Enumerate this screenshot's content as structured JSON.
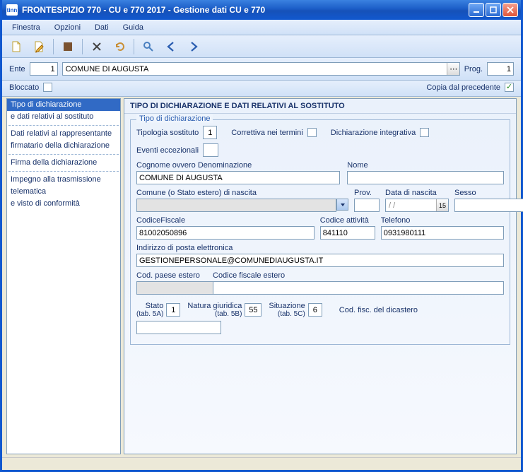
{
  "titlebar": {
    "app_prefix": "tinn",
    "title": "FRONTESPIZIO 770 - CU e 770 2017 - Gestione dati CU e 770"
  },
  "menu": {
    "finestra": "Finestra",
    "opzioni": "Opzioni",
    "dati": "Dati",
    "guida": "Guida"
  },
  "filter": {
    "ente_label": "Ente",
    "ente_value": "1",
    "ente_name": "COMUNE DI AUGUSTA",
    "prog_label": "Prog.",
    "prog_value": "1"
  },
  "lockbar": {
    "bloccato": "Bloccato",
    "bloccato_checked": false,
    "copia": "Copia dal precedente",
    "copia_checked": true
  },
  "nav": {
    "items": [
      {
        "l1": "Tipo di dichiarazione",
        "l2": "e dati relativi al sostituto",
        "selected": true
      },
      {
        "l1": "Dati relativi al rappresentante",
        "l2": "firmatario della dichiarazione"
      },
      {
        "l1": "Firma della dichiarazione",
        "l2": ""
      },
      {
        "l1": "Impegno alla trasmissione",
        "l2": "telematica",
        "l3": "e visto di conformità"
      }
    ]
  },
  "main": {
    "section_title": "TIPO DI DICHIARAZIONE E DATI RELATIVI AL SOSTITUTO",
    "fieldset_legend": "Tipo di dichiarazione",
    "labels": {
      "tipologia_sostituto": "Tipologia sostituto",
      "correttiva": "Correttiva nei termini",
      "integrativa": "Dichiarazione integrativa",
      "eventi": "Eventi eccezionali",
      "cognome_denom": "Cognome ovvero Denominazione",
      "nome": "Nome",
      "comune_nascita": "Comune (o Stato estero) di nascita",
      "prov": "Prov.",
      "data_nascita": "Data di nascita",
      "sesso": "Sesso",
      "codice_fiscale": "CodiceFiscale",
      "codice_attivita": "Codice attività",
      "telefono": "Telefono",
      "email": "Indirizzo di posta elettronica",
      "cod_paese_estero": "Cod. paese estero",
      "codice_fiscale_estero": "Codice fiscale estero",
      "stato": "Stato",
      "stato_sub": "(tab. 5A)",
      "natura_giuridica": "Natura giuridica",
      "natura_sub": "(tab. 5B)",
      "situazione": "Situazione",
      "situazione_sub": "(tab. 5C)",
      "cod_fisc_dicastero": "Cod. fisc. del dicastero"
    },
    "values": {
      "tipologia_sostituto": "1",
      "denominazione": "COMUNE DI AUGUSTA",
      "nome": "",
      "comune_nascita": "",
      "prov": "",
      "data_nascita": "  /  /",
      "sesso": "",
      "codice_fiscale": "81002050896",
      "codice_attivita": "841110",
      "telefono": "0931980111",
      "email": "GESTIONEPERSONALE@COMUNEDIAUGUSTA.IT",
      "cod_paese_estero": "",
      "codice_fiscale_estero": "",
      "stato": "1",
      "natura_giuridica": "55",
      "situazione": "6",
      "cod_fisc_dicastero": ""
    }
  }
}
